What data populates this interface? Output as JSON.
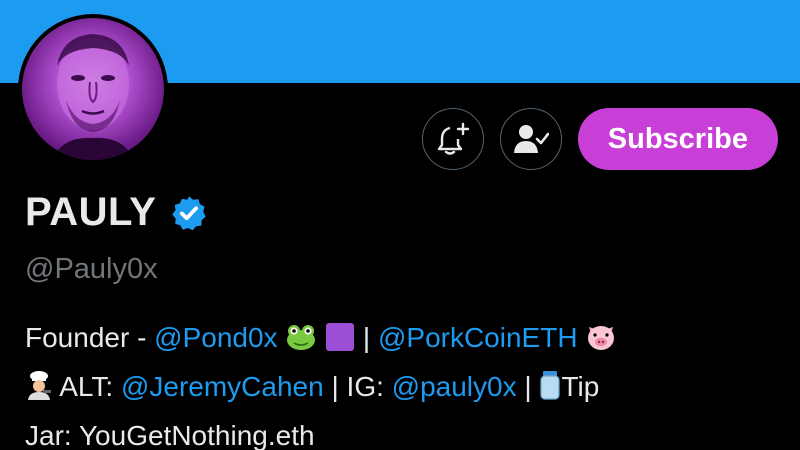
{
  "profile": {
    "display_name": "PAULY",
    "handle": "@Pauly0x",
    "verified": true,
    "avatar_tint": "#b04fd0"
  },
  "actions": {
    "notify_icon": "bell-plus-icon",
    "following_icon": "person-check-icon",
    "subscribe_label": "Subscribe",
    "subscribe_color": "#c83fd8"
  },
  "bio": {
    "line1_prefix": "Founder - ",
    "mention_pond": "@Pond0x",
    "sep1": " | ",
    "mention_pork": "@PorkCoinETH",
    "line2_alt": " ALT: ",
    "mention_jeremy": "@JeremyCahen",
    "ig_label": " | IG: ",
    "mention_ig": "@pauly0x",
    "sep2": " | ",
    "tip_label": "Tip",
    "line3": "Jar: YouGetNothing.eth"
  },
  "colors": {
    "banner": "#1d9bf0",
    "link": "#1d9bf0",
    "muted": "#71767b"
  }
}
